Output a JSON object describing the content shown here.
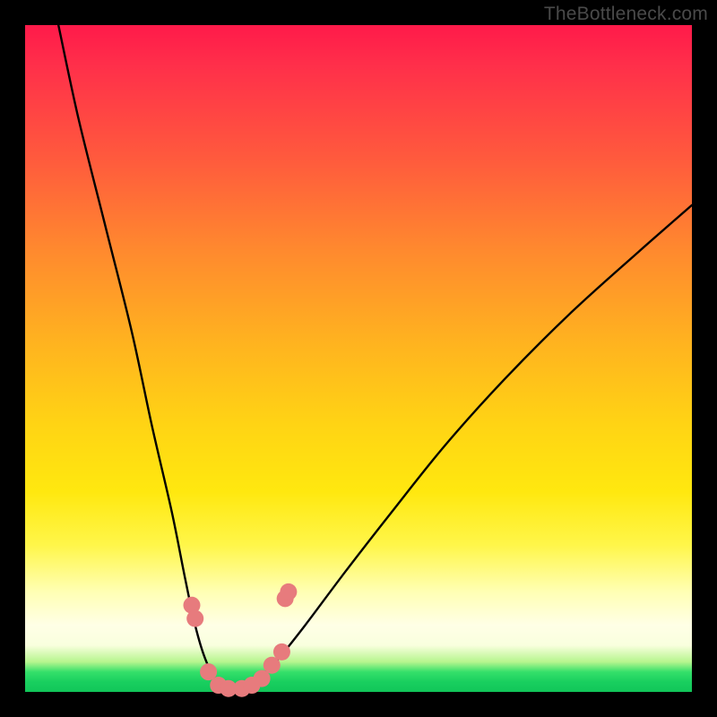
{
  "watermark": "TheBottleneck.com",
  "chart_data": {
    "type": "line",
    "title": "",
    "xlabel": "",
    "ylabel": "",
    "xlim": [
      0,
      100
    ],
    "ylim": [
      0,
      100
    ],
    "series": [
      {
        "name": "bottleneck-curve",
        "x": [
          5,
          8,
          12,
          16,
          19,
          22,
          24,
          25.5,
          27,
          29,
          31,
          33,
          35,
          38,
          42,
          48,
          55,
          63,
          72,
          82,
          92,
          100
        ],
        "values": [
          100,
          86,
          70,
          54,
          40,
          27,
          17,
          10,
          5,
          1,
          0,
          0.5,
          2,
          5,
          10,
          18,
          27,
          37,
          47,
          57,
          66,
          73
        ]
      }
    ],
    "markers": {
      "name": "highlight-dots",
      "color": "#e77b7d",
      "points": [
        {
          "x": 25.0,
          "y": 13
        },
        {
          "x": 25.5,
          "y": 11
        },
        {
          "x": 27.5,
          "y": 3
        },
        {
          "x": 29.0,
          "y": 1
        },
        {
          "x": 30.5,
          "y": 0.5
        },
        {
          "x": 32.5,
          "y": 0.5
        },
        {
          "x": 34.0,
          "y": 1
        },
        {
          "x": 35.5,
          "y": 2
        },
        {
          "x": 37.0,
          "y": 4
        },
        {
          "x": 38.5,
          "y": 6
        },
        {
          "x": 39.0,
          "y": 14
        },
        {
          "x": 39.5,
          "y": 15
        }
      ]
    }
  }
}
